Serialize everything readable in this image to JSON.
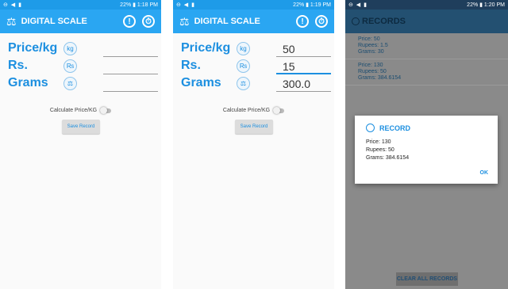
{
  "status": {
    "s1": {
      "left": "⊖ ◀ ▮",
      "right": "22% ▮ 1:18 PM"
    },
    "s2": {
      "left": "⊖ ◀ ▮",
      "right": "22% ▮ 1:19 PM"
    },
    "s3": {
      "left": "⊖ ◀ ▮",
      "right": "22% ▮ 1:20 PM"
    }
  },
  "app": {
    "title": "DIGITAL SCALE",
    "info_icon": "!",
    "timer_icon": "⏱"
  },
  "labels": {
    "price": "Price/kg",
    "rs": "Rs.",
    "grams": "Grams"
  },
  "screen1": {
    "price": "",
    "rs": "",
    "grams": ""
  },
  "screen2": {
    "price": "50",
    "rs": "15",
    "grams": "300.0"
  },
  "toggle_label": "Calculate Price/KG",
  "save_button": "Save Record",
  "records": {
    "title": "RECORDS",
    "items": [
      {
        "price": "Price: 50",
        "rupees": "Rupees: 1.5",
        "grams": "Grams: 30"
      },
      {
        "price": "Price: 130",
        "rupees": "Rupees: 50",
        "grams": "Grams: 384.6154"
      }
    ],
    "clear_button": "CLEAR ALL RECORDS",
    "dialog": {
      "title": "RECORD",
      "price": "Price: 130",
      "rupees": "Rupees: 50",
      "grams": "Grams: 384.6154",
      "ok": "OK"
    }
  },
  "colors": {
    "accent": "#2aa6f2",
    "label": "#1c8fe0",
    "dark_bar": "#235071"
  }
}
